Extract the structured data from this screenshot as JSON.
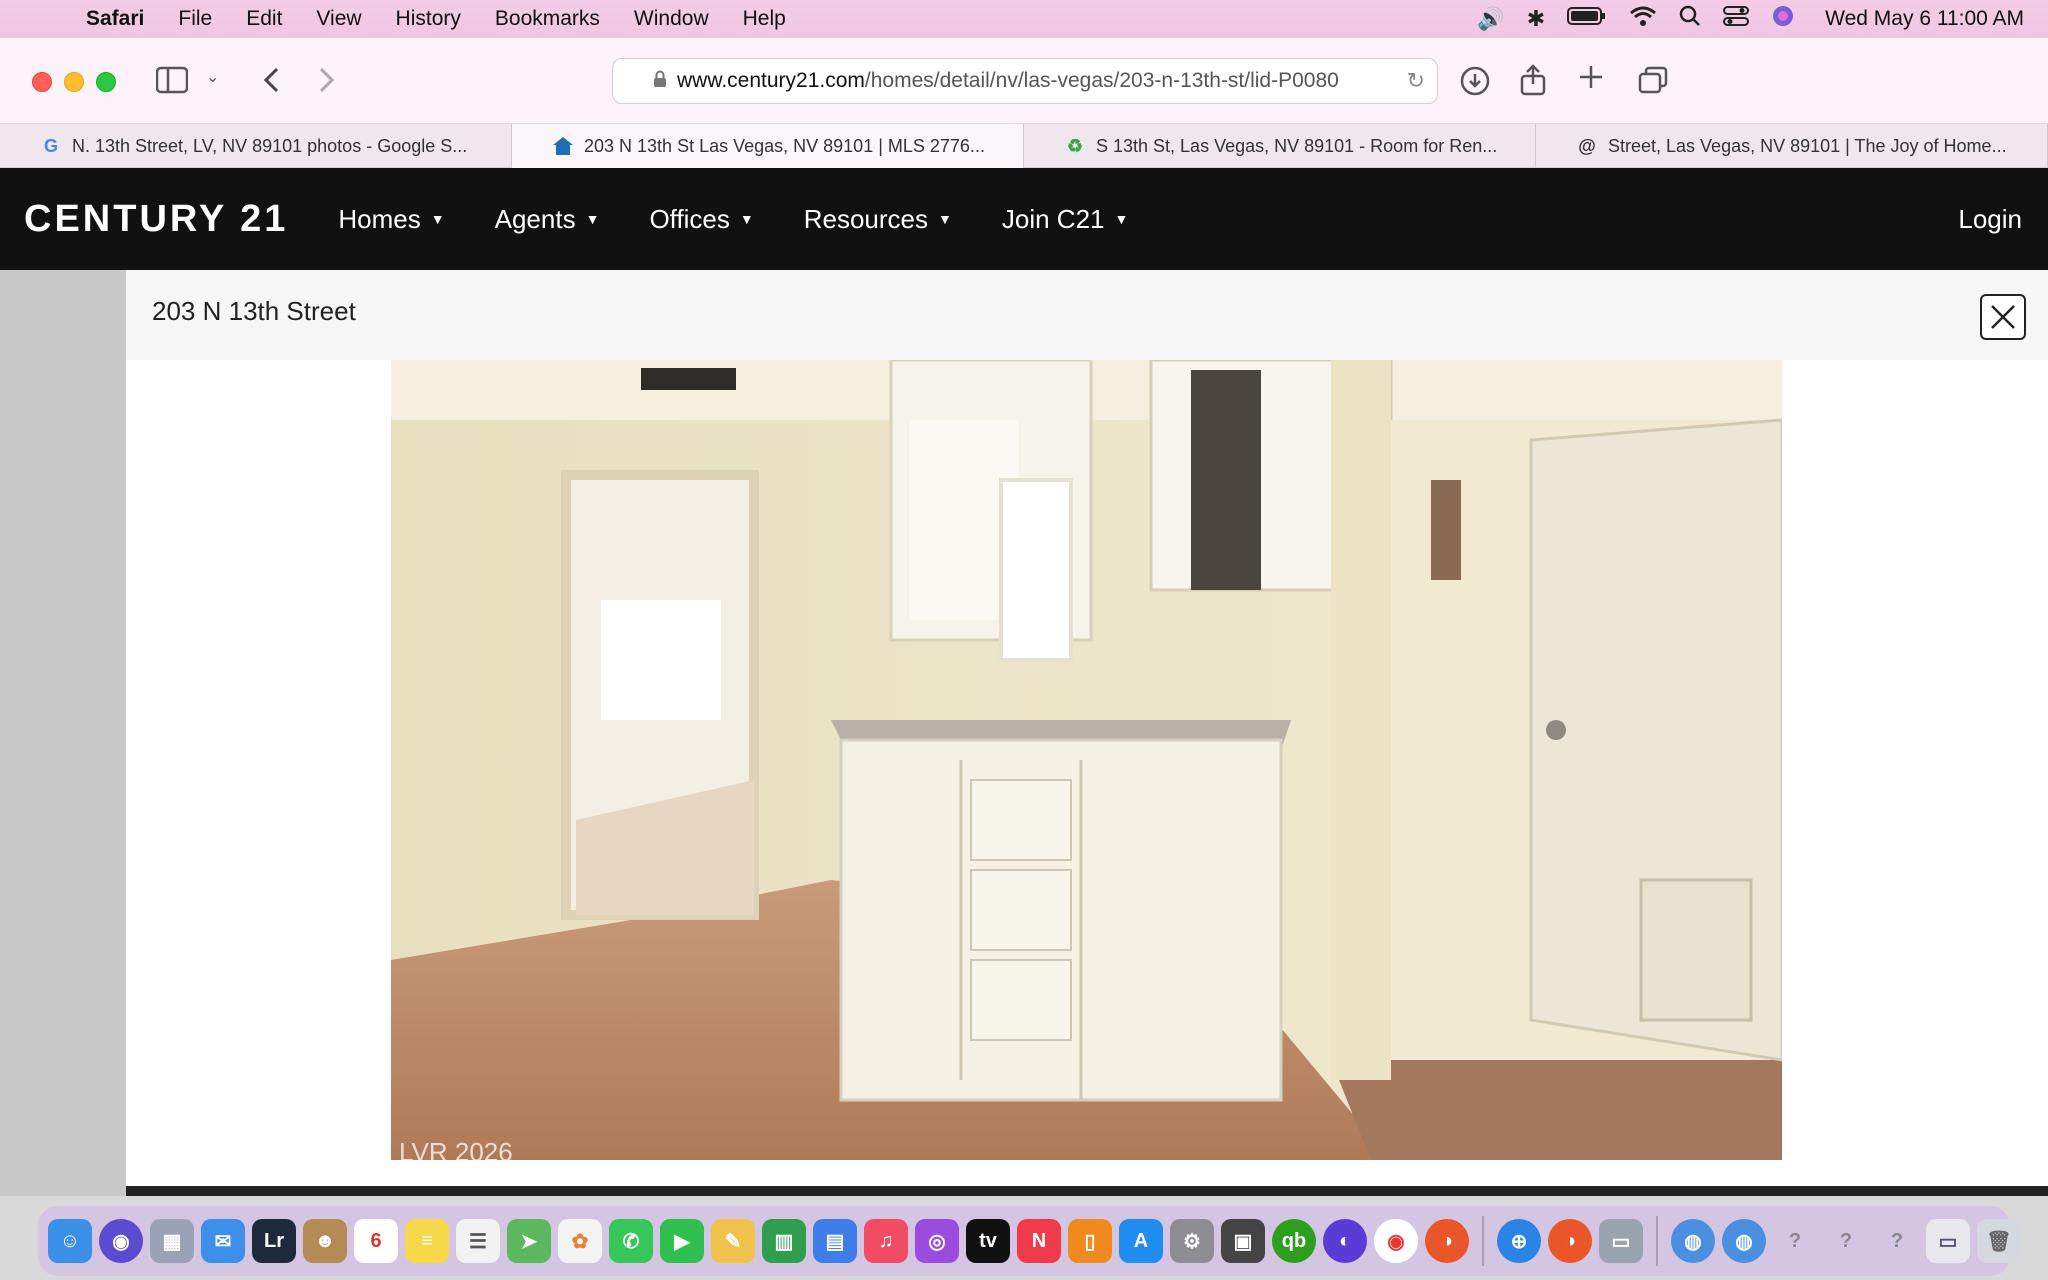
{
  "menubar": {
    "app_name": "Safari",
    "items": [
      "File",
      "Edit",
      "View",
      "History",
      "Bookmarks",
      "Window",
      "Help"
    ],
    "clock": "Wed May 6  11:00 AM"
  },
  "toolbar": {
    "url_host": "www.century21.com",
    "url_path": "/homes/detail/nv/las-vegas/203-n-13th-st/lid-P0080"
  },
  "tabs": [
    {
      "label": "N. 13th Street, LV, NV 89101 photos - Google S...",
      "icon": "google-icon"
    },
    {
      "label": "203 N 13th St Las Vegas, NV 89101 | MLS 2776...",
      "icon": "house-icon"
    },
    {
      "label": "S 13th St, Las Vegas, NV 89101 - Room for Ren...",
      "icon": "recycle-icon"
    },
    {
      "label": "Street, Las Vegas, NV 89101 | The Joy of Home...",
      "icon": "at-icon"
    }
  ],
  "site": {
    "logo": "CENTURY 21",
    "nav": [
      "Homes",
      "Agents",
      "Offices",
      "Resources",
      "Join C21"
    ],
    "login": "Login"
  },
  "modal": {
    "title": "203 N 13th Street",
    "photo_credit": "LVR 2026"
  },
  "colors": {
    "menubar": "#efc6e2",
    "site_header": "#111111",
    "accent_red": "#fe5f57"
  }
}
